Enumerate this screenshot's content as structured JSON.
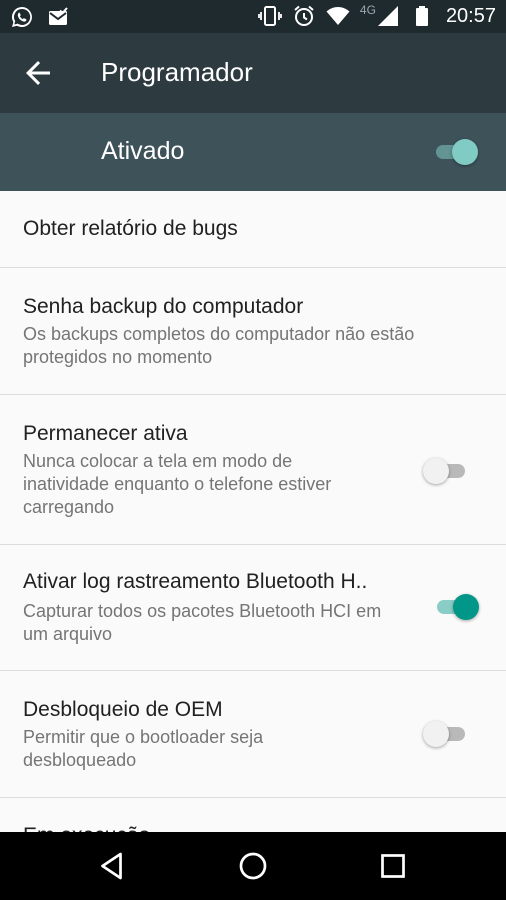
{
  "status_bar": {
    "notification_icons": [
      "whatsapp-icon",
      "gmail-icon"
    ],
    "system_icons": [
      "vibrate-icon",
      "alarm-icon",
      "wifi-icon",
      "signal-icon",
      "battery-icon"
    ],
    "network": "4G",
    "time": "20:57"
  },
  "app_bar": {
    "title": "Programador",
    "back_icon": "arrow-back-icon"
  },
  "master_switch": {
    "label": "Ativado",
    "state": "on"
  },
  "settings": [
    {
      "title": "Obter relatório de bugs"
    },
    {
      "title": "Senha backup do computador",
      "summary": "Os backups completos do computador não estão protegidos no momento"
    },
    {
      "title": "Permanecer ativa",
      "summary": "Nunca colocar a tela em modo de inatividade enquanto o telefone estiver carregando",
      "switch": "off"
    },
    {
      "title": "Ativar log rastreamento Bluetooth H..",
      "summary": "Capturar todos os pacotes Bluetooth HCI em um arquivo",
      "switch": "on"
    },
    {
      "title": "Desbloqueio de OEM",
      "summary": "Permitir que o bootloader seja desbloqueado",
      "switch": "off"
    },
    {
      "title": "Em execução"
    }
  ],
  "nav_bar": [
    "back-triangle-icon",
    "home-circle-icon",
    "recents-square-icon"
  ],
  "colors": {
    "status_bar": "#1f2a2f",
    "app_bar": "#2d3b41",
    "master_bar": "#3e525a",
    "accent": "#009688",
    "background": "#fafafa"
  }
}
